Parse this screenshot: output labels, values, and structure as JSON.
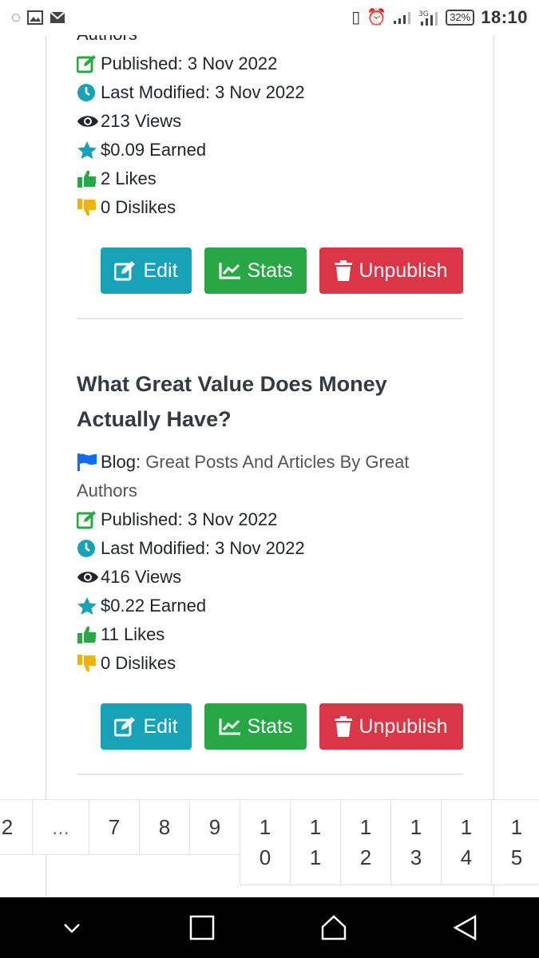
{
  "status_bar": {
    "time": "18:10",
    "battery": "32%"
  },
  "colors": {
    "edit": "#17a2b8",
    "stats": "#28a745",
    "unpublish": "#dc3545",
    "likes": "#28a745",
    "dislikes": "#f0b400",
    "published": "#28a745",
    "clock": "#17a2b8",
    "flag": "#0d6efd",
    "star": "#17a2b8"
  },
  "partial_top_text": "Authors",
  "post1": {
    "published": "Published: 3 Nov 2022",
    "modified": "Last Modified: 3 Nov 2022",
    "views": "213 Views",
    "earned": "$0.09 Earned",
    "likes": "2 Likes",
    "dislikes": "0 Dislikes"
  },
  "post2": {
    "title": "What Great Value Does Money Actually Have?",
    "blog_prefix": "Blog:",
    "blog_name": "Great Posts And Articles By Great",
    "blog_name_cont": "Authors",
    "published": "Published: 3 Nov 2022",
    "modified": "Last Modified: 3 Nov 2022",
    "views": "416 Views",
    "earned": "$0.22 Earned",
    "likes": "11 Likes",
    "dislikes": "0 Dislikes"
  },
  "buttons": {
    "edit": "Edit",
    "stats": "Stats",
    "unpublish": "Unpublish"
  },
  "pagination": {
    "first": "2",
    "dots": "...",
    "single": [
      "7",
      "8",
      "9"
    ],
    "double": [
      [
        "1",
        "0"
      ],
      [
        "1",
        "1"
      ],
      [
        "1",
        "2"
      ],
      [
        "1",
        "3"
      ],
      [
        "1",
        "4"
      ],
      [
        "1",
        "5"
      ]
    ]
  }
}
